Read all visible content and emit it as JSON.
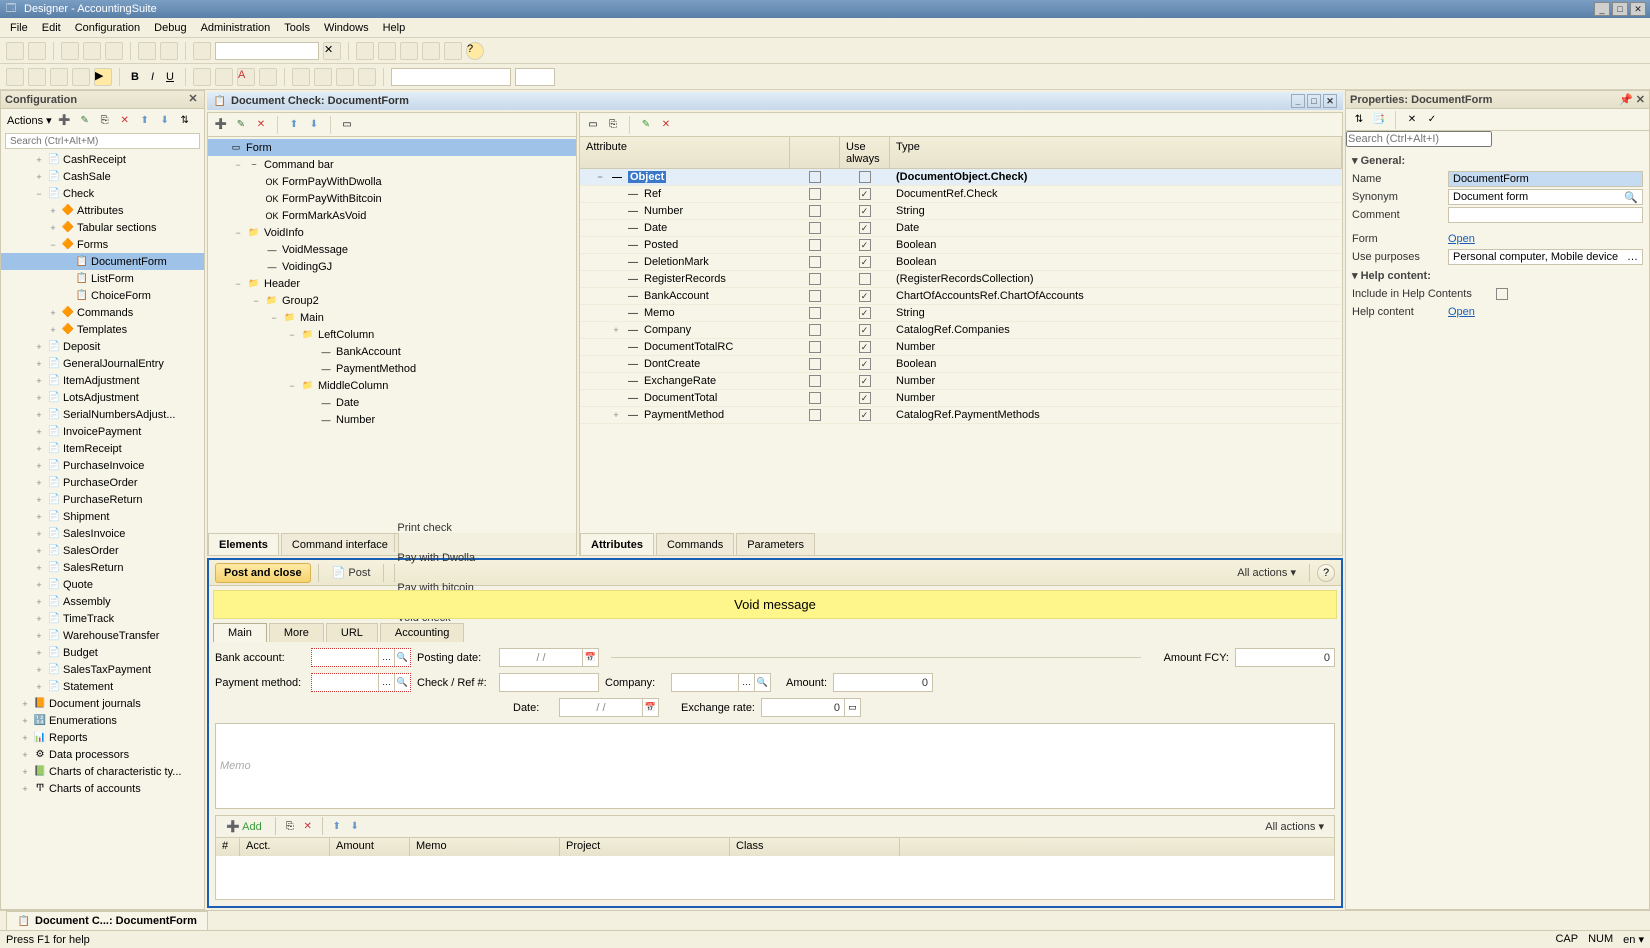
{
  "title": "Designer - AccountingSuite",
  "menus": [
    "File",
    "Edit",
    "Configuration",
    "Debug",
    "Administration",
    "Tools",
    "Windows",
    "Help"
  ],
  "config": {
    "title": "Configuration",
    "actions_label": "Actions",
    "search_placeholder": "Search (Ctrl+Alt+M)",
    "tree": [
      {
        "d": 2,
        "i": "📄",
        "t": "CashReceipt",
        "tw": "+"
      },
      {
        "d": 2,
        "i": "📄",
        "t": "CashSale",
        "tw": "+"
      },
      {
        "d": 2,
        "i": "📄",
        "t": "Check",
        "tw": "−"
      },
      {
        "d": 3,
        "i": "🔶",
        "t": "Attributes",
        "tw": "+"
      },
      {
        "d": 3,
        "i": "🔶",
        "t": "Tabular sections",
        "tw": "+"
      },
      {
        "d": 3,
        "i": "🔶",
        "t": "Forms",
        "tw": "−"
      },
      {
        "d": 4,
        "i": "📋",
        "t": "DocumentForm",
        "sel": true,
        "tw": " "
      },
      {
        "d": 4,
        "i": "📋",
        "t": "ListForm",
        "tw": " "
      },
      {
        "d": 4,
        "i": "📋",
        "t": "ChoiceForm",
        "tw": " "
      },
      {
        "d": 3,
        "i": "🔶",
        "t": "Commands",
        "tw": "+"
      },
      {
        "d": 3,
        "i": "🔶",
        "t": "Templates",
        "tw": "+"
      },
      {
        "d": 2,
        "i": "📄",
        "t": "Deposit",
        "tw": "+"
      },
      {
        "d": 2,
        "i": "📄",
        "t": "GeneralJournalEntry",
        "tw": "+"
      },
      {
        "d": 2,
        "i": "📄",
        "t": "ItemAdjustment",
        "tw": "+"
      },
      {
        "d": 2,
        "i": "📄",
        "t": "LotsAdjustment",
        "tw": "+"
      },
      {
        "d": 2,
        "i": "📄",
        "t": "SerialNumbersAdjust...",
        "tw": "+"
      },
      {
        "d": 2,
        "i": "📄",
        "t": "InvoicePayment",
        "tw": "+"
      },
      {
        "d": 2,
        "i": "📄",
        "t": "ItemReceipt",
        "tw": "+"
      },
      {
        "d": 2,
        "i": "📄",
        "t": "PurchaseInvoice",
        "tw": "+"
      },
      {
        "d": 2,
        "i": "📄",
        "t": "PurchaseOrder",
        "tw": "+"
      },
      {
        "d": 2,
        "i": "📄",
        "t": "PurchaseReturn",
        "tw": "+"
      },
      {
        "d": 2,
        "i": "📄",
        "t": "Shipment",
        "tw": "+"
      },
      {
        "d": 2,
        "i": "📄",
        "t": "SalesInvoice",
        "tw": "+"
      },
      {
        "d": 2,
        "i": "📄",
        "t": "SalesOrder",
        "tw": "+"
      },
      {
        "d": 2,
        "i": "📄",
        "t": "SalesReturn",
        "tw": "+"
      },
      {
        "d": 2,
        "i": "📄",
        "t": "Quote",
        "tw": "+"
      },
      {
        "d": 2,
        "i": "📄",
        "t": "Assembly",
        "tw": "+"
      },
      {
        "d": 2,
        "i": "📄",
        "t": "TimeTrack",
        "tw": "+"
      },
      {
        "d": 2,
        "i": "📄",
        "t": "WarehouseTransfer",
        "tw": "+"
      },
      {
        "d": 2,
        "i": "📄",
        "t": "Budget",
        "tw": "+"
      },
      {
        "d": 2,
        "i": "📄",
        "t": "SalesTaxPayment",
        "tw": "+"
      },
      {
        "d": 2,
        "i": "📄",
        "t": "Statement",
        "tw": "+"
      },
      {
        "d": 1,
        "i": "📙",
        "t": "Document journals",
        "tw": "+"
      },
      {
        "d": 1,
        "i": "🔢",
        "t": "Enumerations",
        "tw": "+"
      },
      {
        "d": 1,
        "i": "📊",
        "t": "Reports",
        "tw": "+"
      },
      {
        "d": 1,
        "i": "⚙",
        "t": "Data processors",
        "tw": "+"
      },
      {
        "d": 1,
        "i": "📗",
        "t": "Charts of characteristic ty...",
        "tw": "+"
      },
      {
        "d": 1,
        "i": "Ͳ",
        "t": "Charts of accounts",
        "tw": "+"
      }
    ]
  },
  "doc": {
    "title": "Document Check: DocumentForm",
    "form_tree": [
      {
        "d": 0,
        "i": "▭",
        "t": "Form",
        "sel": true
      },
      {
        "d": 1,
        "i": "⎯",
        "t": "Command bar",
        "tw": "−"
      },
      {
        "d": 2,
        "i": "OK",
        "t": "FormPayWithDwolla"
      },
      {
        "d": 2,
        "i": "OK",
        "t": "FormPayWithBitcoin"
      },
      {
        "d": 2,
        "i": "OK",
        "t": "FormMarkAsVoid"
      },
      {
        "d": 1,
        "i": "📁",
        "t": "VoidInfo",
        "tw": "−"
      },
      {
        "d": 2,
        "i": "—",
        "t": "VoidMessage"
      },
      {
        "d": 2,
        "i": "—",
        "t": "VoidingGJ"
      },
      {
        "d": 1,
        "i": "📁",
        "t": "Header",
        "tw": "−"
      },
      {
        "d": 2,
        "i": "📁",
        "t": "Group2",
        "tw": "−"
      },
      {
        "d": 3,
        "i": "📁",
        "t": "Main",
        "tw": "−"
      },
      {
        "d": 4,
        "i": "📁",
        "t": "LeftColumn",
        "tw": "−"
      },
      {
        "d": 5,
        "i": "—",
        "t": "BankAccount"
      },
      {
        "d": 5,
        "i": "—",
        "t": "PaymentMethod"
      },
      {
        "d": 4,
        "i": "📁",
        "t": "MiddleColumn",
        "tw": "−"
      },
      {
        "d": 5,
        "i": "—",
        "t": "Date"
      },
      {
        "d": 5,
        "i": "—",
        "t": "Number"
      }
    ],
    "left_tabs": [
      "Elements",
      "Command interface"
    ],
    "attr_head": {
      "c0": "Attribute",
      "c1": "Use always",
      "c2": "Type"
    },
    "attrs": [
      {
        "n": "Object",
        "t": "(DocumentObject.Check)",
        "ua": "",
        "sel": true,
        "bold": true,
        "tw": "−"
      },
      {
        "n": "Ref",
        "t": "DocumentRef.Check",
        "ua": "✓",
        "tw": " "
      },
      {
        "n": "Number",
        "t": "String",
        "ua": "✓",
        "tw": " "
      },
      {
        "n": "Date",
        "t": "Date",
        "ua": "✓",
        "tw": " "
      },
      {
        "n": "Posted",
        "t": "Boolean",
        "ua": "✓",
        "tw": " "
      },
      {
        "n": "DeletionMark",
        "t": "Boolean",
        "ua": "✓",
        "tw": " "
      },
      {
        "n": "RegisterRecords",
        "t": "(RegisterRecordsCollection)",
        "ua": "",
        "tw": " "
      },
      {
        "n": "BankAccount",
        "t": "ChartOfAccountsRef.ChartOfAccounts",
        "ua": "✓",
        "tw": " "
      },
      {
        "n": "Memo",
        "t": "String",
        "ua": "✓",
        "tw": " "
      },
      {
        "n": "Company",
        "t": "CatalogRef.Companies",
        "ua": "✓",
        "tw": "+"
      },
      {
        "n": "DocumentTotalRC",
        "t": "Number",
        "ua": "✓",
        "tw": " "
      },
      {
        "n": "DontCreate",
        "t": "Boolean",
        "ua": "✓",
        "tw": " "
      },
      {
        "n": "ExchangeRate",
        "t": "Number",
        "ua": "✓",
        "tw": " "
      },
      {
        "n": "DocumentTotal",
        "t": "Number",
        "ua": "✓",
        "tw": " "
      },
      {
        "n": "PaymentMethod",
        "t": "CatalogRef.PaymentMethods",
        "ua": "✓",
        "tw": "+"
      }
    ],
    "right_tabs": [
      "Attributes",
      "Commands",
      "Parameters"
    ]
  },
  "preview": {
    "post_close": "Post and close",
    "post": "Post",
    "actions": [
      "Print check",
      "Pay with Dwolla",
      "Pay with bitcoin",
      "Void check"
    ],
    "all_actions": "All actions",
    "void_msg": "Void message",
    "tabs": [
      "Main",
      "More",
      "URL",
      "Accounting"
    ],
    "labels": {
      "bank": "Bank account:",
      "posting": "Posting date:",
      "amountfcy": "Amount FCY:",
      "payment": "Payment method:",
      "checkref": "Check / Ref #:",
      "company": "Company:",
      "amount": "Amount:",
      "date": "Date:",
      "exrate": "Exchange rate:",
      "memo": "Memo",
      "add": "Add"
    },
    "values": {
      "amountfcy": "0",
      "amount": "0",
      "exrate": "0",
      "dateph": ". .",
      "posting_ph": "/   /"
    },
    "grid_cols": [
      "#",
      "Acct.",
      "Amount",
      "Memo",
      "Project",
      "Class"
    ]
  },
  "props": {
    "title": "Properties: DocumentForm",
    "search_ph": "Search (Ctrl+Alt+I)",
    "sec_general": "General:",
    "sec_help": "Help content:",
    "name_l": "Name",
    "name_v": "DocumentForm",
    "syn_l": "Synonym",
    "syn_v": "Document form",
    "com_l": "Comment",
    "com_v": "",
    "form_l": "Form",
    "form_v": "Open",
    "use_l": "Use purposes",
    "use_v": "Personal computer, Mobile device",
    "inc_l": "Include in Help Contents",
    "hc_l": "Help content",
    "hc_v": "Open"
  },
  "bottom_tab": "Document C...: DocumentForm",
  "status": {
    "msg": "Press F1 for help",
    "cap": "CAP",
    "num": "NUM",
    "lang": "en"
  }
}
